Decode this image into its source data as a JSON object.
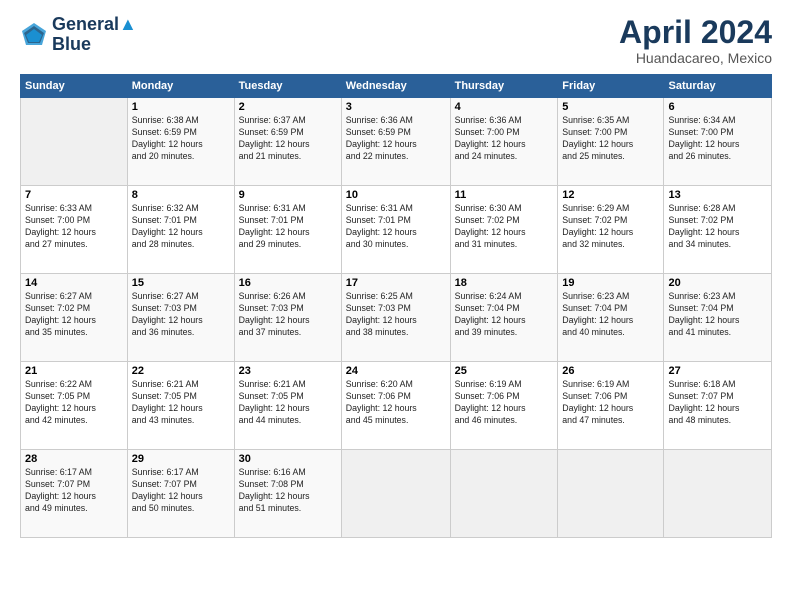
{
  "header": {
    "logo_line1": "General",
    "logo_line2": "Blue",
    "month": "April 2024",
    "location": "Huandacareo, Mexico"
  },
  "weekdays": [
    "Sunday",
    "Monday",
    "Tuesday",
    "Wednesday",
    "Thursday",
    "Friday",
    "Saturday"
  ],
  "weeks": [
    [
      {
        "day": "",
        "info": ""
      },
      {
        "day": "1",
        "info": "Sunrise: 6:38 AM\nSunset: 6:59 PM\nDaylight: 12 hours\nand 20 minutes."
      },
      {
        "day": "2",
        "info": "Sunrise: 6:37 AM\nSunset: 6:59 PM\nDaylight: 12 hours\nand 21 minutes."
      },
      {
        "day": "3",
        "info": "Sunrise: 6:36 AM\nSunset: 6:59 PM\nDaylight: 12 hours\nand 22 minutes."
      },
      {
        "day": "4",
        "info": "Sunrise: 6:36 AM\nSunset: 7:00 PM\nDaylight: 12 hours\nand 24 minutes."
      },
      {
        "day": "5",
        "info": "Sunrise: 6:35 AM\nSunset: 7:00 PM\nDaylight: 12 hours\nand 25 minutes."
      },
      {
        "day": "6",
        "info": "Sunrise: 6:34 AM\nSunset: 7:00 PM\nDaylight: 12 hours\nand 26 minutes."
      }
    ],
    [
      {
        "day": "7",
        "info": "Sunrise: 6:33 AM\nSunset: 7:00 PM\nDaylight: 12 hours\nand 27 minutes."
      },
      {
        "day": "8",
        "info": "Sunrise: 6:32 AM\nSunset: 7:01 PM\nDaylight: 12 hours\nand 28 minutes."
      },
      {
        "day": "9",
        "info": "Sunrise: 6:31 AM\nSunset: 7:01 PM\nDaylight: 12 hours\nand 29 minutes."
      },
      {
        "day": "10",
        "info": "Sunrise: 6:31 AM\nSunset: 7:01 PM\nDaylight: 12 hours\nand 30 minutes."
      },
      {
        "day": "11",
        "info": "Sunrise: 6:30 AM\nSunset: 7:02 PM\nDaylight: 12 hours\nand 31 minutes."
      },
      {
        "day": "12",
        "info": "Sunrise: 6:29 AM\nSunset: 7:02 PM\nDaylight: 12 hours\nand 32 minutes."
      },
      {
        "day": "13",
        "info": "Sunrise: 6:28 AM\nSunset: 7:02 PM\nDaylight: 12 hours\nand 34 minutes."
      }
    ],
    [
      {
        "day": "14",
        "info": "Sunrise: 6:27 AM\nSunset: 7:02 PM\nDaylight: 12 hours\nand 35 minutes."
      },
      {
        "day": "15",
        "info": "Sunrise: 6:27 AM\nSunset: 7:03 PM\nDaylight: 12 hours\nand 36 minutes."
      },
      {
        "day": "16",
        "info": "Sunrise: 6:26 AM\nSunset: 7:03 PM\nDaylight: 12 hours\nand 37 minutes."
      },
      {
        "day": "17",
        "info": "Sunrise: 6:25 AM\nSunset: 7:03 PM\nDaylight: 12 hours\nand 38 minutes."
      },
      {
        "day": "18",
        "info": "Sunrise: 6:24 AM\nSunset: 7:04 PM\nDaylight: 12 hours\nand 39 minutes."
      },
      {
        "day": "19",
        "info": "Sunrise: 6:23 AM\nSunset: 7:04 PM\nDaylight: 12 hours\nand 40 minutes."
      },
      {
        "day": "20",
        "info": "Sunrise: 6:23 AM\nSunset: 7:04 PM\nDaylight: 12 hours\nand 41 minutes."
      }
    ],
    [
      {
        "day": "21",
        "info": "Sunrise: 6:22 AM\nSunset: 7:05 PM\nDaylight: 12 hours\nand 42 minutes."
      },
      {
        "day": "22",
        "info": "Sunrise: 6:21 AM\nSunset: 7:05 PM\nDaylight: 12 hours\nand 43 minutes."
      },
      {
        "day": "23",
        "info": "Sunrise: 6:21 AM\nSunset: 7:05 PM\nDaylight: 12 hours\nand 44 minutes."
      },
      {
        "day": "24",
        "info": "Sunrise: 6:20 AM\nSunset: 7:06 PM\nDaylight: 12 hours\nand 45 minutes."
      },
      {
        "day": "25",
        "info": "Sunrise: 6:19 AM\nSunset: 7:06 PM\nDaylight: 12 hours\nand 46 minutes."
      },
      {
        "day": "26",
        "info": "Sunrise: 6:19 AM\nSunset: 7:06 PM\nDaylight: 12 hours\nand 47 minutes."
      },
      {
        "day": "27",
        "info": "Sunrise: 6:18 AM\nSunset: 7:07 PM\nDaylight: 12 hours\nand 48 minutes."
      }
    ],
    [
      {
        "day": "28",
        "info": "Sunrise: 6:17 AM\nSunset: 7:07 PM\nDaylight: 12 hours\nand 49 minutes."
      },
      {
        "day": "29",
        "info": "Sunrise: 6:17 AM\nSunset: 7:07 PM\nDaylight: 12 hours\nand 50 minutes."
      },
      {
        "day": "30",
        "info": "Sunrise: 6:16 AM\nSunset: 7:08 PM\nDaylight: 12 hours\nand 51 minutes."
      },
      {
        "day": "",
        "info": ""
      },
      {
        "day": "",
        "info": ""
      },
      {
        "day": "",
        "info": ""
      },
      {
        "day": "",
        "info": ""
      }
    ]
  ]
}
